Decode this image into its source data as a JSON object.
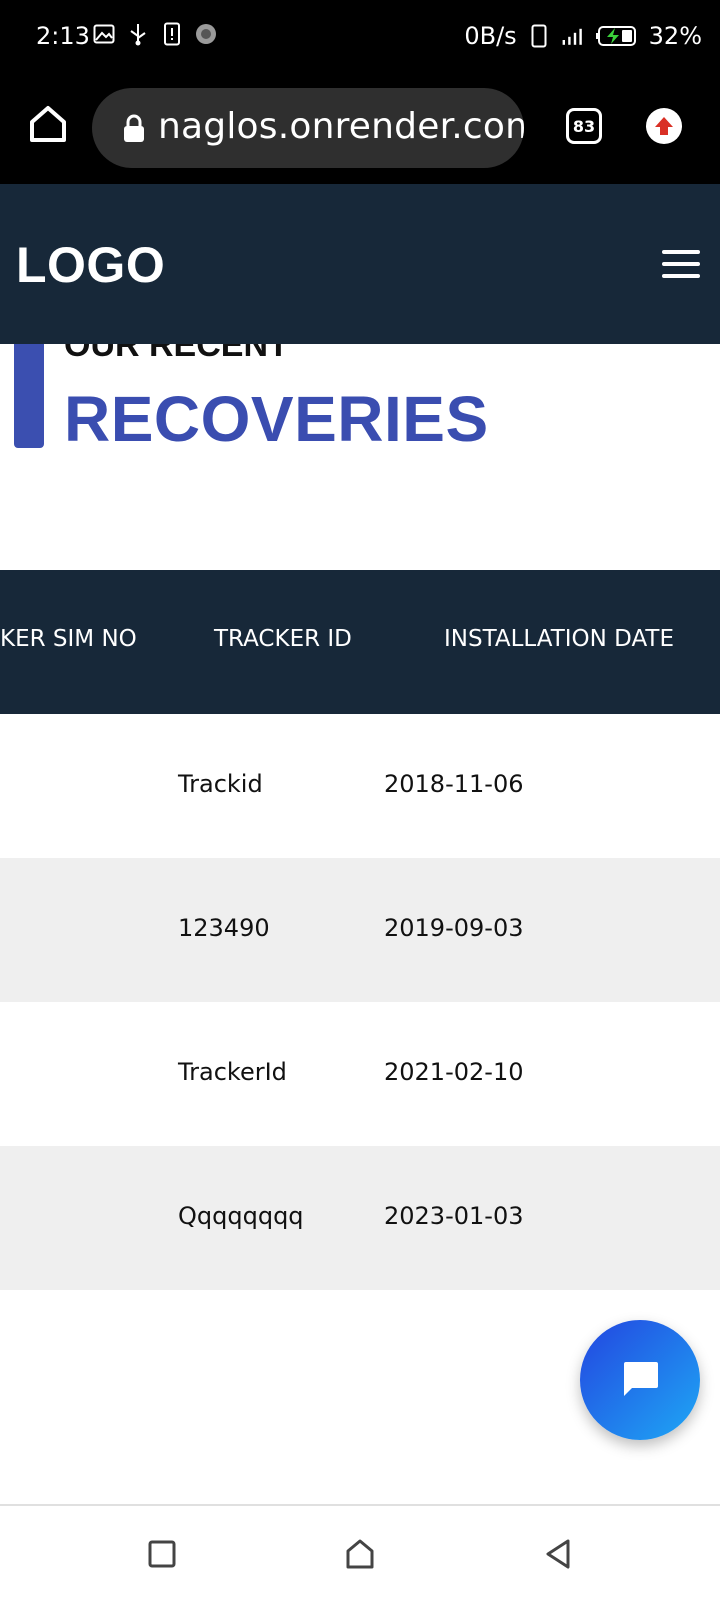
{
  "status_bar": {
    "time": "2:13",
    "net_speed": "0B/s",
    "battery": "32%",
    "icons": [
      "image-icon",
      "usb-icon",
      "alert-icon",
      "activity-icon",
      "phone-icon",
      "signal-3g-icon",
      "battery-charging-icon"
    ]
  },
  "browser": {
    "url": "naglos.onrender.com",
    "tab_count": "83"
  },
  "site": {
    "logo": "LOGO"
  },
  "section": {
    "subtitle": "OUR RECENT",
    "title": "RECOVERIES"
  },
  "table": {
    "headers": [
      "KER SIM NO",
      "TRACKER ID",
      "INSTALLATION DATE"
    ],
    "rows": [
      {
        "tracker_id": "Trackid",
        "installation_date": "2018-11-06"
      },
      {
        "tracker_id": "123490",
        "installation_date": "2019-09-03"
      },
      {
        "tracker_id": "TrackerId",
        "installation_date": "2021-02-10"
      },
      {
        "tracker_id": "Qqqqqqqq",
        "installation_date": "2023-01-03"
      }
    ]
  },
  "colors": {
    "header_bg": "#172839",
    "accent": "#3a4db0",
    "row_alt": "#efefef"
  }
}
